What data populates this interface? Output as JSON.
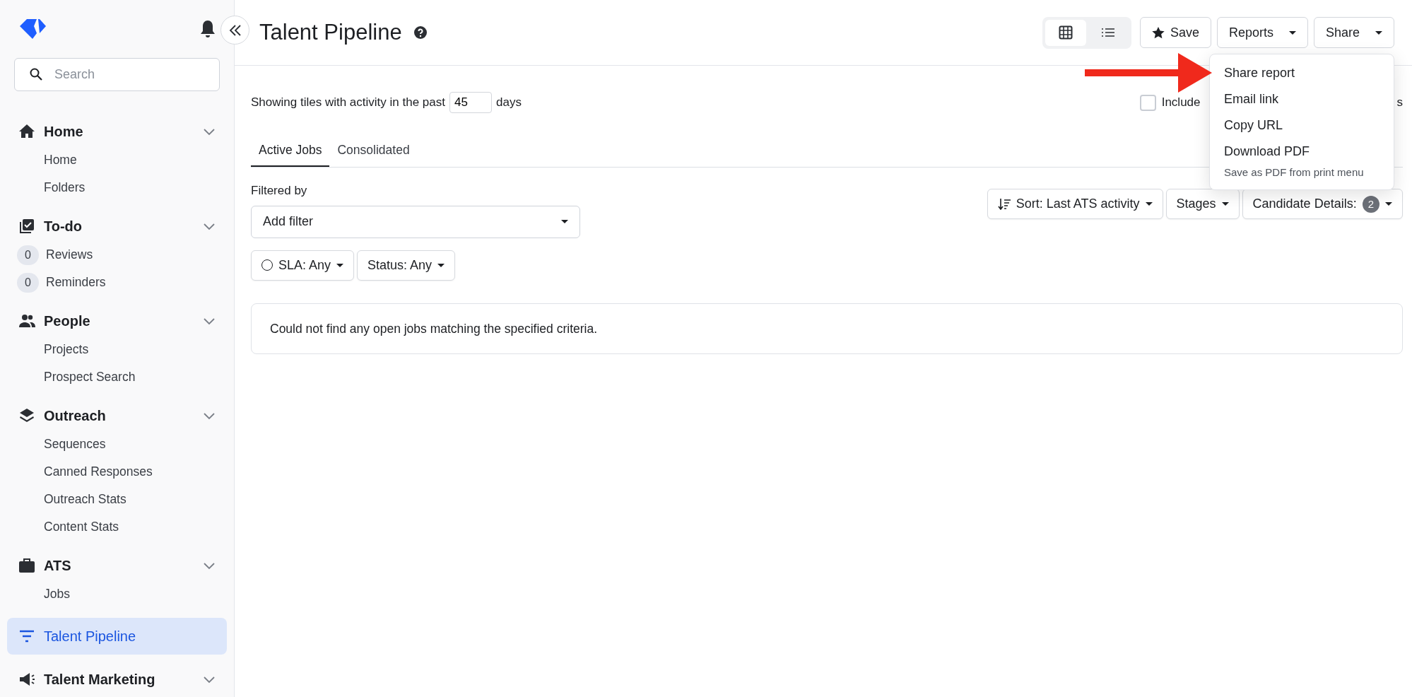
{
  "sidebar": {
    "search": {
      "placeholder": "Search"
    },
    "sections": [
      {
        "kind": "home",
        "label": "Home",
        "selected": false,
        "items": [
          {
            "label": "Home"
          },
          {
            "label": "Folders"
          }
        ]
      },
      {
        "kind": "todo",
        "label": "To-do",
        "selected": false,
        "items": [
          {
            "label": "Reviews",
            "count": "0"
          },
          {
            "label": "Reminders",
            "count": "0"
          }
        ]
      },
      {
        "kind": "people",
        "label": "People",
        "selected": false,
        "items": [
          {
            "label": "Projects"
          },
          {
            "label": "Prospect Search"
          }
        ]
      },
      {
        "kind": "outreach",
        "label": "Outreach",
        "selected": false,
        "items": [
          {
            "label": "Sequences"
          },
          {
            "label": "Canned Responses"
          },
          {
            "label": "Outreach Stats"
          },
          {
            "label": "Content Stats"
          }
        ]
      },
      {
        "kind": "ats",
        "label": "ATS",
        "selected": false,
        "items": [
          {
            "label": "Jobs"
          }
        ]
      },
      {
        "kind": "pipeline",
        "label": "Talent Pipeline",
        "selected": true
      },
      {
        "kind": "marketing",
        "label": "Talent Marketing",
        "selected": false
      }
    ]
  },
  "header": {
    "title": "Talent Pipeline",
    "view_toggle": [
      {
        "kind": "grid",
        "selected": true
      },
      {
        "kind": "list",
        "selected": false
      }
    ],
    "buttons": [
      {
        "kind": "star",
        "label": "Save"
      },
      {
        "kind": "caret",
        "label": "Reports"
      },
      {
        "kind": "caret",
        "label": "Share"
      }
    ]
  },
  "menu": {
    "items": [
      {
        "label": "Share report"
      },
      {
        "label": "Email link"
      },
      {
        "label": "Copy URL"
      },
      {
        "label": "Download PDF",
        "hint": "Save as PDF from print menu"
      }
    ]
  },
  "annotations": [
    {
      "kind": "arrow"
    }
  ],
  "activity": {
    "prefix": "Showing tiles with activity in the past",
    "value": "45",
    "suffix": "days"
  },
  "include": {
    "checked": false,
    "label": "Include",
    "label_tail": "s"
  },
  "tabs": [
    {
      "label": "Active Jobs",
      "selected": true
    },
    {
      "label": "Consolidated",
      "selected": false
    }
  ],
  "filters": {
    "label": "Filtered by",
    "select": "Add filter",
    "chips": [
      {
        "kind": "radio",
        "label": "SLA: Any"
      },
      {
        "kind": "plain",
        "label": "Status: Any"
      }
    ]
  },
  "toolbar": [
    {
      "kind": "sort",
      "label": "Sort: Last ATS activity"
    },
    {
      "kind": "plain",
      "label": "Stages"
    },
    {
      "kind": "count",
      "label": "Candidate Details:",
      "count": "2"
    }
  ],
  "empty_message": "Could not find any open jobs matching the specified criteria."
}
